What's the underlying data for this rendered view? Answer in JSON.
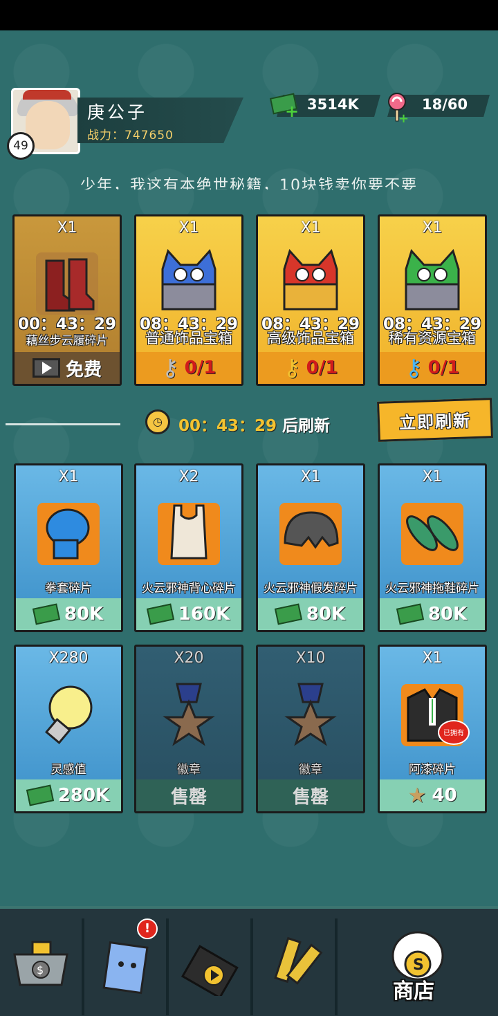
{
  "player": {
    "name": "庚公子",
    "power": "战力：747650",
    "level": "49"
  },
  "resources": {
    "cash": "3514K",
    "energy": "18/60"
  },
  "slogan": "少年，我这有本绝世秘籍，10块钱卖你要不要",
  "top_cards": [
    {
      "qty": "X1",
      "timer": "00：43：29",
      "label": "藕丝步云履碎片",
      "footer": "免费",
      "style": "brown"
    },
    {
      "qty": "X1",
      "timer": "08：43：29",
      "label": "普通饰品宝箱",
      "footer": "0/1",
      "style": "gold",
      "key_color": "#bdbdbd",
      "chest_color": "#3d6fd8"
    },
    {
      "qty": "X1",
      "timer": "08：43：29",
      "label": "高级饰品宝箱",
      "footer": "0/1",
      "style": "gold",
      "key_color": "#f2c230",
      "chest_color": "#d8362a"
    },
    {
      "qty": "X1",
      "timer": "08：43：29",
      "label": "稀有资源宝箱",
      "footer": "0/1",
      "style": "gold",
      "key_color": "#4fb6ef",
      "chest_color": "#3bb24a"
    }
  ],
  "refresh": {
    "time": "00：43：29",
    "suffix": "后刷新",
    "button": "立即刷新"
  },
  "shop_items": [
    {
      "qty": "X1",
      "label": "拳套碎片",
      "price": "80K",
      "currency": "cash",
      "style": "blue",
      "art": "glove"
    },
    {
      "qty": "X2",
      "label": "火云邪神背心碎片",
      "price": "160K",
      "currency": "cash",
      "style": "blue",
      "art": "vest"
    },
    {
      "qty": "X1",
      "label": "火云邪神假发碎片",
      "price": "80K",
      "currency": "cash",
      "style": "blue",
      "art": "wig"
    },
    {
      "qty": "X1",
      "label": "火云邪神拖鞋碎片",
      "price": "80K",
      "currency": "cash",
      "style": "blue",
      "art": "slippers"
    },
    {
      "qty": "X280",
      "label": "灵感值",
      "price": "280K",
      "currency": "cash",
      "style": "blue",
      "art": "bulb"
    },
    {
      "qty": "X20",
      "label": "徽章",
      "price": "售罄",
      "currency": "none",
      "style": "dark",
      "art": "medal"
    },
    {
      "qty": "X10",
      "label": "徽章",
      "price": "售罄",
      "currency": "none",
      "style": "dark",
      "art": "medal"
    },
    {
      "qty": "X1",
      "label": "阿漆碎片",
      "price": "40",
      "currency": "medal",
      "style": "blue",
      "art": "suit",
      "owned": "已拥有"
    }
  ],
  "nav": {
    "shop_label": "商店",
    "notification": "!"
  }
}
